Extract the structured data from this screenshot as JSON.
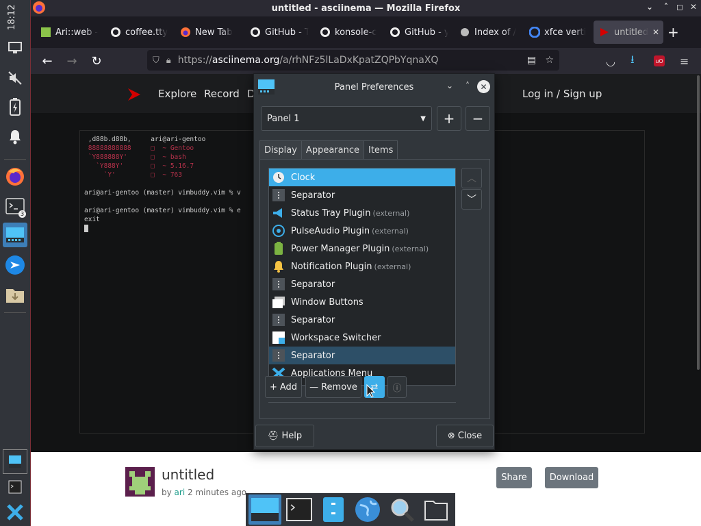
{
  "panel": {
    "clock": "18:12",
    "terminal_badge": "3"
  },
  "window": {
    "title": "untitled - asciinema — Mozilla Firefox"
  },
  "tabs": [
    {
      "label": "Ari::web -"
    },
    {
      "label": "coffee.tty"
    },
    {
      "label": "New Tab"
    },
    {
      "label": "GitHub - T"
    },
    {
      "label": "konsole-c"
    },
    {
      "label": "GitHub - y"
    },
    {
      "label": "Index of /"
    },
    {
      "label": "xfce verti"
    },
    {
      "label": "untitled"
    }
  ],
  "url": {
    "prefix": "https://",
    "host": "asciinema.org",
    "path": "/a/rhNFz5lLaDxKpatZQPbYqnaXQ"
  },
  "site": {
    "nav": [
      "Explore",
      "Record",
      "D"
    ],
    "login": "Log in / Sign up"
  },
  "terminal": {
    "lines": [
      " ,d88b.d88b,     ari@ari-gentoo",
      " 88888888888     □  ~ Gentoo",
      " `Y888888Y'      □  ~ bash",
      "   `Y888Y'       □  ~ 5.16.7",
      "     `Y'         □  ~ 763",
      "",
      "ari@ari-gentoo (master) vimbuddy.vim % v",
      "",
      "ari@ari-gentoo (master) vimbuddy.vim % e",
      "exit"
    ]
  },
  "cast": {
    "title": "untitled",
    "by": "by",
    "author": "ari",
    "time": "2 minutes ago",
    "share": "Share",
    "download": "Download"
  },
  "dialog": {
    "title": "Panel Preferences",
    "panel_select": "Panel 1",
    "tabs": [
      "Display",
      "Appearance",
      "Items"
    ],
    "items": [
      {
        "name": "Clock",
        "ext": ""
      },
      {
        "name": "Separator",
        "ext": ""
      },
      {
        "name": "Status Tray Plugin",
        "ext": "(external)"
      },
      {
        "name": "PulseAudio Plugin",
        "ext": "(external)"
      },
      {
        "name": "Power Manager Plugin",
        "ext": "(external)"
      },
      {
        "name": "Notification Plugin",
        "ext": "(external)"
      },
      {
        "name": "Separator",
        "ext": ""
      },
      {
        "name": "Window Buttons",
        "ext": ""
      },
      {
        "name": "Separator",
        "ext": ""
      },
      {
        "name": "Workspace Switcher",
        "ext": ""
      },
      {
        "name": "Separator",
        "ext": ""
      },
      {
        "name": "Applications Menu",
        "ext": ""
      }
    ],
    "add": "Add",
    "remove": "Remove",
    "help": "Help",
    "close": "Close"
  },
  "colors": {
    "accent": "#3daee9",
    "dialog_bg": "#31363b",
    "firefox_bg": "#2b2a33"
  }
}
